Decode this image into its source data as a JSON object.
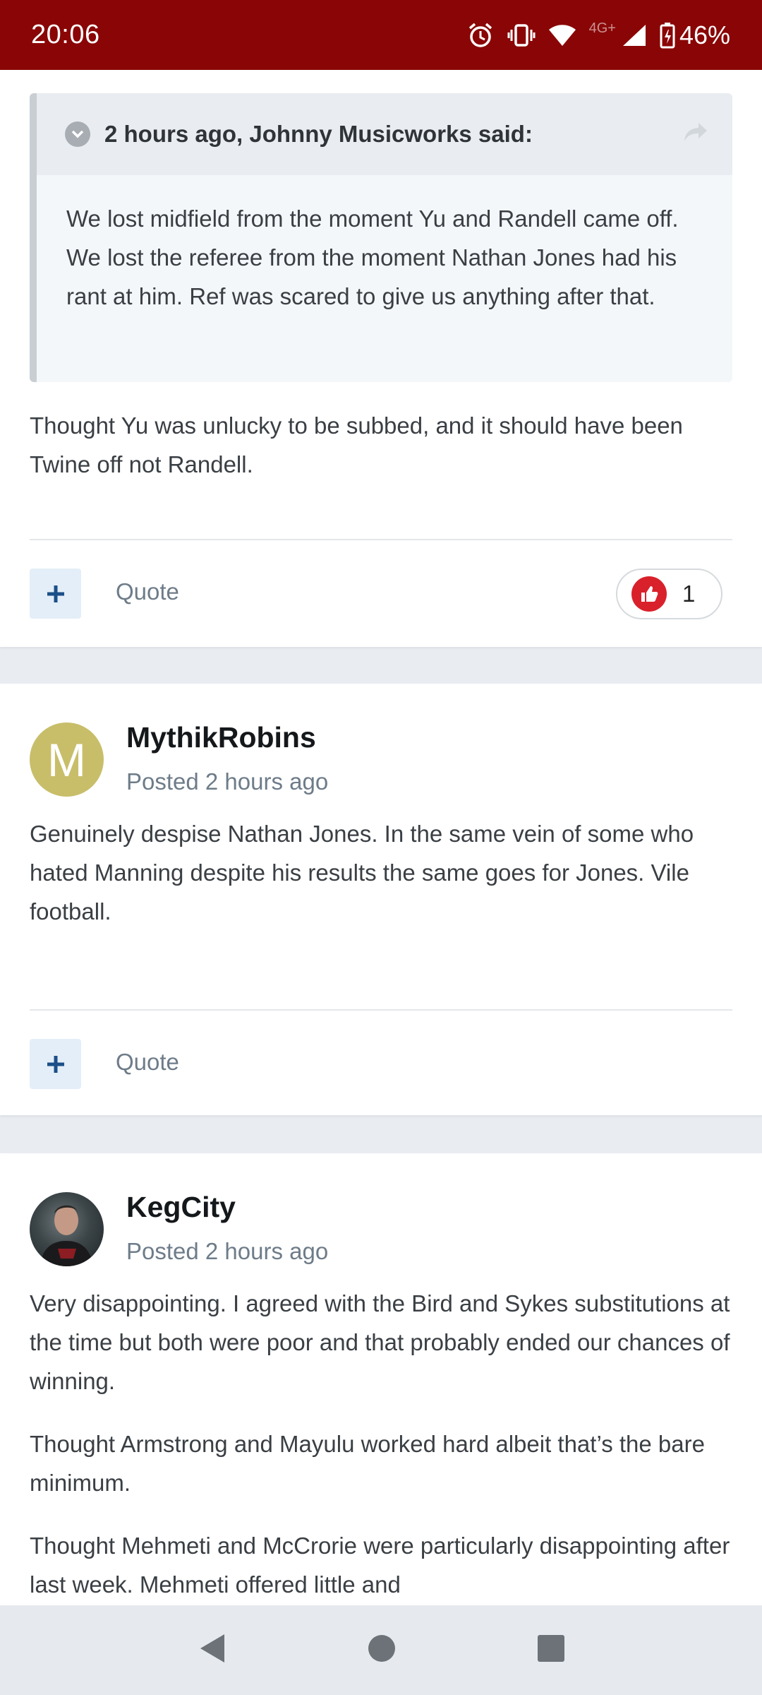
{
  "status_bar": {
    "time": "20:06",
    "network": "4G+",
    "battery": "46%"
  },
  "posts": [
    {
      "quote": {
        "header": "2 hours ago, Johnny Musicworks said:",
        "text": "We lost midfield from the moment Yu and Randell came off. We lost the referee from the moment Nathan Jones had his rant at him. Ref was scared to give us anything after that."
      },
      "body": [
        "Thought Yu was unlucky to be subbed, and it should have been Twine off not Randell."
      ],
      "actions": {
        "quote_label": "Quote",
        "reaction_count": "1"
      }
    },
    {
      "author": "MythikRobins",
      "avatar_letter": "M",
      "posted": "Posted 2 hours ago",
      "body": [
        "Genuinely despise Nathan Jones. In the same vein of some who hated Manning despite his results the same goes for Jones. Vile football."
      ],
      "actions": {
        "quote_label": "Quote"
      }
    },
    {
      "author": "KegCity",
      "posted": "Posted 2 hours ago",
      "body": [
        "Very disappointing. I agreed with the Bird and Sykes substitutions at the time but both were poor and that probably ended our chances of winning.",
        "Thought Armstrong and Mayulu worked hard albeit that’s the bare minimum.",
        "Thought Mehmeti and McCrorie were particularly disappointing after last week. Mehmeti offered little and"
      ]
    }
  ],
  "colors": {
    "status_bar": "#8a0606",
    "reaction": "#d9212b",
    "avatar_m": "#c8be6a"
  },
  "icons": [
    "alarm-icon",
    "vibrate-icon",
    "wifi-icon",
    "signal-icon",
    "battery-icon",
    "chevron-down-icon",
    "share-icon",
    "plus-icon",
    "thumbs-up-icon",
    "back-icon",
    "home-icon",
    "recents-icon"
  ]
}
